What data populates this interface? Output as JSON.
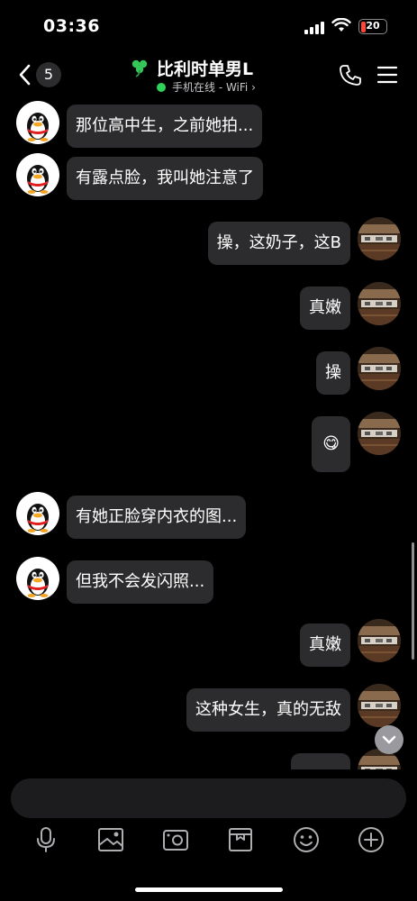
{
  "status_bar": {
    "time": "03:36",
    "battery": "20",
    "battery_level": 0.2
  },
  "header": {
    "back_count": "5",
    "title": "比利时单男L",
    "presence": "手机在线 - WiFi ›"
  },
  "messages": [
    {
      "side": "left",
      "text": "那位高中生，之前她拍..."
    },
    {
      "side": "left",
      "text": "有露点脸，我叫她注意了"
    },
    {
      "side": "right",
      "text": "操，这奶子，这B"
    },
    {
      "side": "right",
      "text": "真嫩"
    },
    {
      "side": "right",
      "text": "操"
    },
    {
      "side": "right",
      "text": "😋"
    },
    {
      "side": "left",
      "text": "有她正脸穿内衣的图..."
    },
    {
      "side": "left",
      "text": "但我不会发闪照..."
    },
    {
      "side": "right",
      "text": "真嫩"
    },
    {
      "side": "right",
      "text": "这种女生，真的无敌"
    },
    {
      "side": "right",
      "text": ""
    }
  ],
  "toolbar": {
    "items": [
      "microphone-icon",
      "image-icon",
      "camera-icon",
      "file-box-icon",
      "emoji-icon",
      "plus-icon"
    ]
  },
  "colors": {
    "background": "#000000",
    "bubble": "#2c2c2e",
    "online": "#30d158",
    "battery_low": "#ff453a"
  }
}
